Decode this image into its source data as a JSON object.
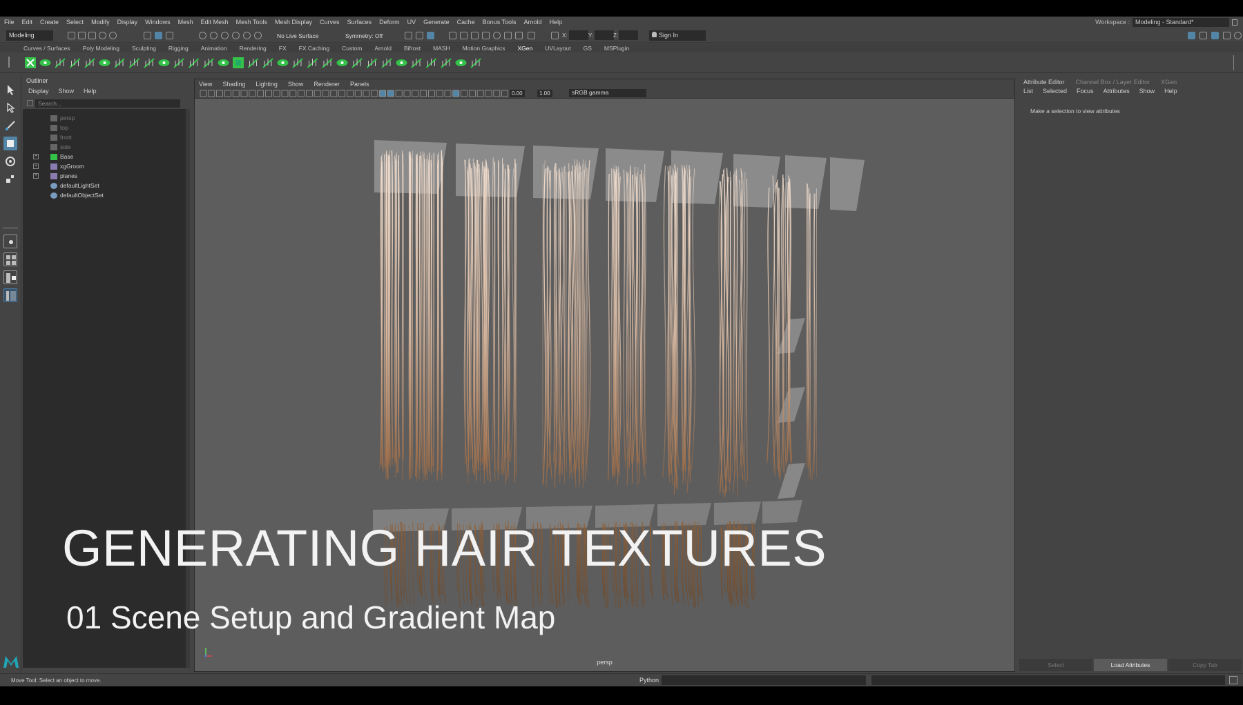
{
  "menubar": [
    "File",
    "Edit",
    "Create",
    "Select",
    "Modify",
    "Display",
    "Windows",
    "Mesh",
    "Edit Mesh",
    "Mesh Tools",
    "Mesh Display",
    "Curves",
    "Surfaces",
    "Deform",
    "UV",
    "Generate",
    "Cache",
    "Bonus Tools",
    "Arnold",
    "Help"
  ],
  "workspace": {
    "label": "Workspace :",
    "value": "Modeling - Standard*"
  },
  "statusline": {
    "menuset": "Modeling",
    "live_surface": "No Live Surface",
    "symmetry": "Symmetry: Off",
    "x_label": "X:",
    "y_label": "Y:",
    "z_label": "Z:",
    "sign_in": "Sign In"
  },
  "shelf_tabs": [
    "Curves / Surfaces",
    "Poly Modeling",
    "Sculpting",
    "Rigging",
    "Animation",
    "Rendering",
    "FX",
    "FX Caching",
    "Custom",
    "Arnold",
    "Bifrost",
    "MASH",
    "Motion Graphics",
    "XGen",
    "UVLayout",
    "GS",
    "MSPlugin"
  ],
  "shelf_active": "XGen",
  "outliner": {
    "tab": "Outliner",
    "menu": [
      "Display",
      "Show",
      "Help"
    ],
    "search_placeholder": "Search...",
    "items": [
      "persp",
      "top",
      "front",
      "side",
      "Base",
      "xgGroom",
      "planes",
      "defaultLightSet",
      "defaultObjectSet"
    ]
  },
  "viewport": {
    "menu": [
      "View",
      "Shading",
      "Lighting",
      "Show",
      "Renderer",
      "Panels"
    ],
    "exposure": "0.00",
    "gamma": "1.00",
    "color_space": "sRGB gamma",
    "camera": "persp"
  },
  "overlay": {
    "title": "GENERATING HAIR TEXTURES",
    "subtitle": "01 Scene Setup and Gradient Map"
  },
  "attribute_editor": {
    "tabs": [
      "Attribute Editor",
      "Channel Box / Layer Editor",
      "XGen"
    ],
    "menu": [
      "List",
      "Selected",
      "Focus",
      "Attributes",
      "Show",
      "Help"
    ],
    "message": "Make a selection to view attributes",
    "buttons": [
      "Select",
      "Load Attributes",
      "Copy Tab"
    ]
  },
  "helpline": {
    "help": "Move Tool: Select an object to move.",
    "python": "Python"
  },
  "colors": {
    "xgen_green": "#35c24a",
    "selected_blue": "#5285a6",
    "hair_light": "#efdccd",
    "hair_dark": "#9b6a45"
  }
}
